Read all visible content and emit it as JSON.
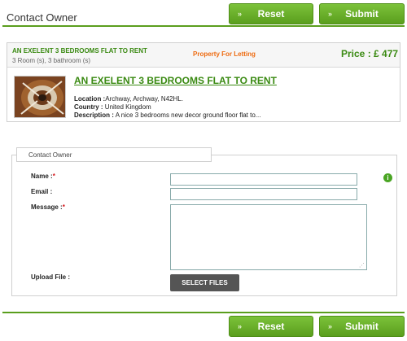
{
  "header": {
    "title": "Contact Owner"
  },
  "buttons": {
    "reset": "Reset",
    "submit": "Submit"
  },
  "listing": {
    "name": "AN EXELENT 3 BEDROOMS FLAT TO RENT",
    "rooms": "3 Room (s), 3 bathroom (s)",
    "type": "Property For Letting",
    "price": "Price : £ 477",
    "heading": "AN EXELENT 3 BEDROOMS FLAT TO RENT",
    "location_label": "Location :",
    "location_value": "Archway, Archway, N42HL.",
    "country_label": "Country :",
    "country_value": " United Kingdom",
    "description_label": "Description :",
    "description_value": " A nice 3 bedrooms new decor ground floor flat to..."
  },
  "form": {
    "legend": "Contact Owner",
    "name_label": "Name :",
    "email_label": "Email :",
    "message_label": "Message :",
    "upload_label": "Upload File :",
    "select_files": "SELECT FILES",
    "required_mark": "*"
  },
  "colors": {
    "brand_green": "#5a9e1d",
    "accent_orange": "#ee6b10",
    "required_red": "#d4151a"
  },
  "icons": {
    "info": "info-icon",
    "arrow": "double-arrow-right-icon"
  }
}
